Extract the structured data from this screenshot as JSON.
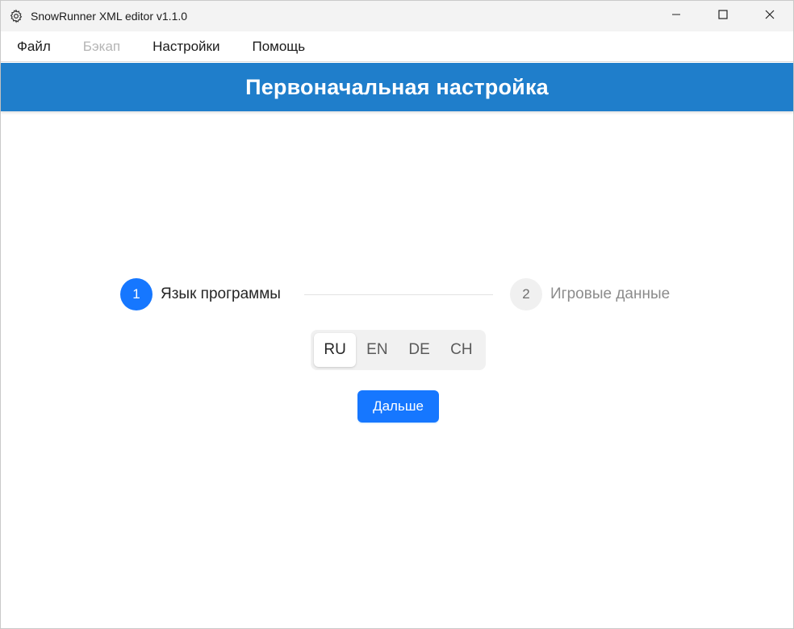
{
  "window": {
    "title": "SnowRunner XML editor v1.1.0",
    "app_icon": "gear-icon",
    "controls": [
      "minimize-icon",
      "maximize-icon",
      "close-icon"
    ]
  },
  "menu": {
    "items": [
      {
        "label": "Файл",
        "enabled": true
      },
      {
        "label": "Бэкап",
        "enabled": false
      },
      {
        "label": "Настройки",
        "enabled": true
      },
      {
        "label": "Помощь",
        "enabled": true
      }
    ]
  },
  "header": {
    "title": "Первоначальная настройка",
    "color": "#1f7ecb"
  },
  "stepper": {
    "steps": [
      {
        "number": "1",
        "label": "Язык программы",
        "status": "active"
      },
      {
        "number": "2",
        "label": "Игровые данные",
        "status": "pending"
      }
    ],
    "accent": "#1677ff"
  },
  "language_selector": {
    "options": [
      "RU",
      "EN",
      "DE",
      "CH"
    ],
    "selected": "RU"
  },
  "next_button": {
    "label": "Дальше"
  }
}
